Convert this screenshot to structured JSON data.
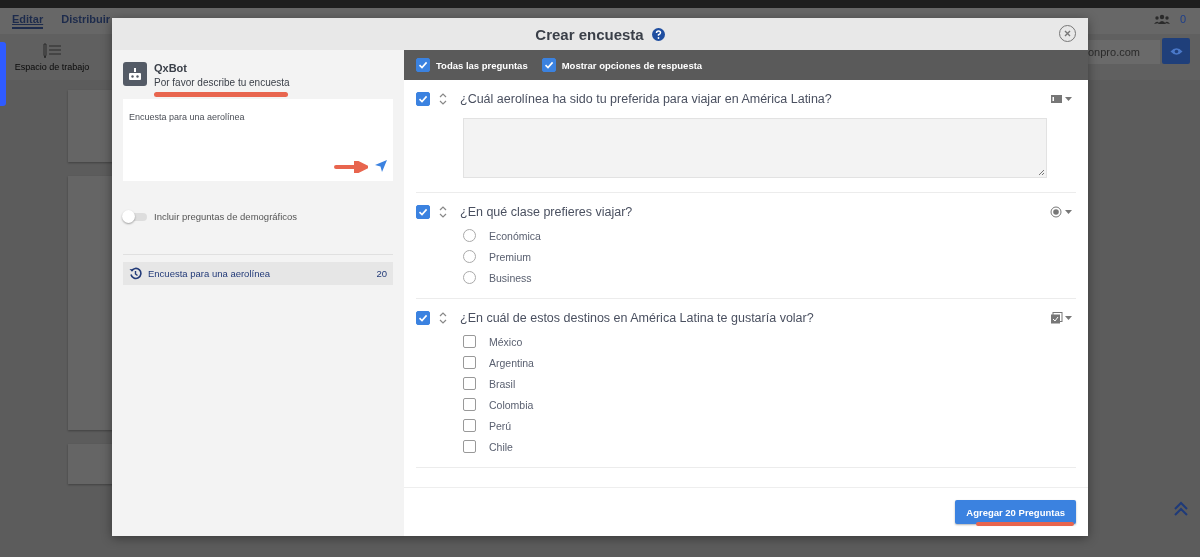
{
  "app": {
    "tabs": [
      {
        "label": "Editar",
        "selected": true
      },
      {
        "label": "Distribuir",
        "selected": false
      }
    ],
    "tools": [
      {
        "label": "Espacio de trabajo"
      }
    ],
    "collaborators_count": "0",
    "url_fragment": "onpro.com"
  },
  "dialog": {
    "title": "Crear encuesta",
    "bot": {
      "name": "QxBot",
      "prompt": "Por favor describe tu encuesta"
    },
    "description": {
      "value": "Encuesta para una aerolínea"
    },
    "demographics_toggle": {
      "label": "Incluir preguntas de demográficos",
      "on": false
    },
    "history": [
      {
        "label": "Encuesta para una aerolínea",
        "count": "20"
      }
    ],
    "toolbar": [
      {
        "label": "Todas las preguntas",
        "checked": true
      },
      {
        "label": "Mostrar opciones de respuesta",
        "checked": true
      }
    ],
    "questions": [
      {
        "kind": "text",
        "text": "¿Cuál aerolínea ha sido tu preferida para viajar en América Latina?",
        "checked": true
      },
      {
        "kind": "single",
        "text": "¿En qué clase prefieres viajar?",
        "checked": true,
        "options": [
          {
            "label": "Económica",
            "selected": false
          },
          {
            "label": "Premium",
            "selected": false
          },
          {
            "label": "Business",
            "selected": false
          }
        ]
      },
      {
        "kind": "multi",
        "text": "¿En cuál de estos destinos en América Latina te gustaría volar?",
        "checked": true,
        "options": [
          {
            "label": "México",
            "checked": false
          },
          {
            "label": "Argentina",
            "checked": false
          },
          {
            "label": "Brasil",
            "checked": false
          },
          {
            "label": "Colombia",
            "checked": false
          },
          {
            "label": "Perú",
            "checked": false
          },
          {
            "label": "Chile",
            "checked": false
          }
        ]
      }
    ],
    "submit": "Agregar 20 Preguntas"
  }
}
